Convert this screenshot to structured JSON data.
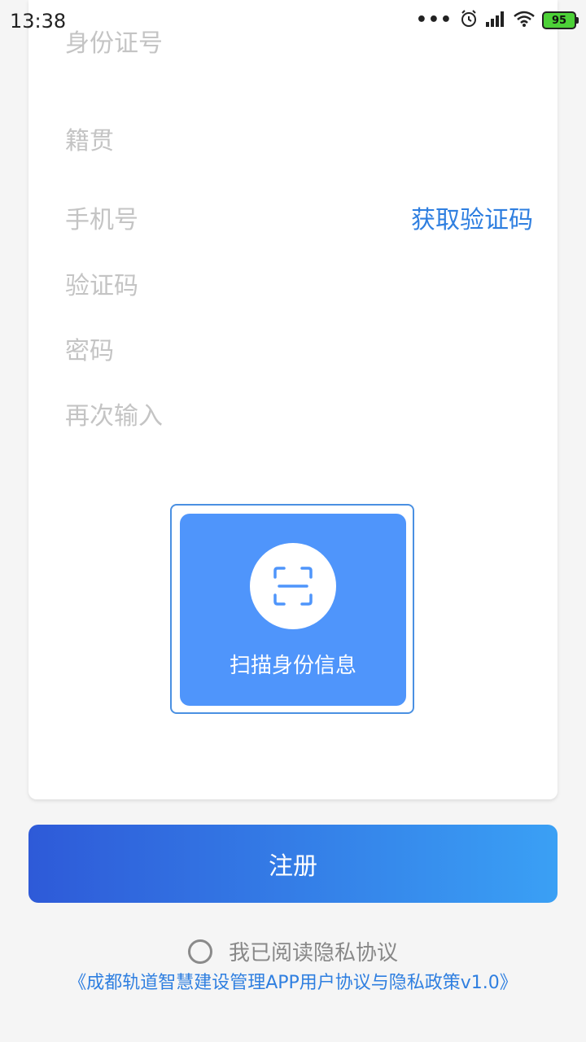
{
  "status_bar": {
    "time": "13:38",
    "more_dots": "•••",
    "battery": "95"
  },
  "form": {
    "id_number_placeholder": "身份证号",
    "native_place_placeholder": "籍贯",
    "phone_placeholder": "手机号",
    "get_code_label": "获取验证码",
    "verify_code_placeholder": "验证码",
    "password_placeholder": "密码",
    "confirm_password_placeholder": "再次输入"
  },
  "scan": {
    "label": "扫描身份信息",
    "icon": "scan-icon"
  },
  "register_button": "注册",
  "agreement": {
    "checkbox_label": "我已阅读隐私协议",
    "policy_link": "《成都轨道智慧建设管理APP用户协议与隐私政策v1.0》"
  },
  "colors": {
    "accent": "#2f7fe0",
    "scan_bg": "#4f95fb",
    "button_gradient_start": "#2e5ad8",
    "button_gradient_end": "#3aa0f5",
    "placeholder": "#c4c4c4"
  }
}
